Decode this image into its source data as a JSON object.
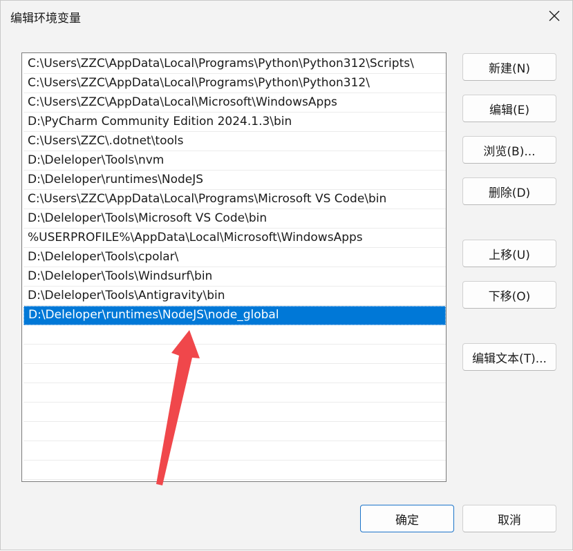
{
  "dialog": {
    "title": "编辑环境变量",
    "close_icon": "close-icon"
  },
  "paths": [
    "C:\\Users\\ZZC\\AppData\\Local\\Programs\\Python\\Python312\\Scripts\\",
    "C:\\Users\\ZZC\\AppData\\Local\\Programs\\Python\\Python312\\",
    "C:\\Users\\ZZC\\AppData\\Local\\Microsoft\\WindowsApps",
    "D:\\PyCharm Community Edition 2024.1.3\\bin",
    "C:\\Users\\ZZC\\.dotnet\\tools",
    "D:\\Deleloper\\Tools\\nvm",
    "D:\\Deleloper\\runtimes\\NodeJS",
    "C:\\Users\\ZZC\\AppData\\Local\\Programs\\Microsoft VS Code\\bin",
    "D:\\Deleloper\\Tools\\Microsoft VS Code\\bin",
    "%USERPROFILE%\\AppData\\Local\\Microsoft\\WindowsApps",
    "D:\\Deleloper\\Tools\\cpolar\\",
    "D:\\Deleloper\\Tools\\Windsurf\\bin",
    "D:\\Deleloper\\Tools\\Antigravity\\bin",
    "D:\\Deleloper\\runtimes\\NodeJS\\node_global"
  ],
  "selected_index": 13,
  "buttons": {
    "new": "新建(N)",
    "edit": "编辑(E)",
    "browse": "浏览(B)...",
    "delete": "删除(D)",
    "move_up": "上移(U)",
    "move_down": "下移(O)",
    "edit_text": "编辑文本(T)...",
    "ok": "确定",
    "cancel": "取消"
  },
  "annotation": {
    "arrow_color": "#f0474b",
    "icon": "red-arrow-annotation"
  },
  "colors": {
    "selection": "#0078d7",
    "dialog_bg": "#f3f3f3"
  }
}
